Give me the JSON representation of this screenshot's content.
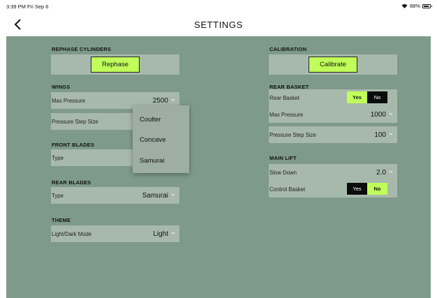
{
  "status_bar": {
    "time": "3:39 PM  Fri Sep 6",
    "battery": "88%",
    "battery_level": 0.88
  },
  "nav": {
    "title": "SETTINGS"
  },
  "icons": {
    "back": "chevron-left-icon",
    "wifi": "wifi-icon",
    "battery": "battery-icon"
  },
  "colors": {
    "panel": "#7e9a89",
    "row": "#a7b9ab",
    "accent": "#c0ff5a",
    "dark": "#0c0c0c"
  },
  "rephase": {
    "header": "REPHASE CYLINDERS",
    "button": "Rephase"
  },
  "wings": {
    "header": "WINGS",
    "max_pressure_label": "Max Pressure",
    "max_pressure_value": "2500",
    "step_label": "Pressure Step Size"
  },
  "front_blades": {
    "header": "FRONT BLADES",
    "type_label": "Type"
  },
  "rear_blades": {
    "header": "REAR BLADES",
    "type_label": "Type",
    "type_value": "Samurai"
  },
  "theme": {
    "header": "THEME",
    "mode_label": "Light/Dark Mode",
    "mode_value": "Light"
  },
  "calibration": {
    "header": "CALIBRATION",
    "button": "Calibrate"
  },
  "rear_basket": {
    "header": "REAR BASKET",
    "basket_label": "Rear Basket",
    "yes": "Yes",
    "no": "No",
    "selected": "Yes",
    "max_pressure_label": "Max Pressure",
    "max_pressure_value": "1000",
    "step_label": "Pressure Step Size",
    "step_value": "100"
  },
  "main_lift": {
    "header": "MAIN LIFT",
    "slow_label": "Slow Down",
    "slow_value": "2.0",
    "control_label": "Control Basket",
    "yes": "Yes",
    "no": "No",
    "selected": "No"
  },
  "dropdown": {
    "options": [
      "Coulter",
      "Concave",
      "Samurai"
    ]
  }
}
